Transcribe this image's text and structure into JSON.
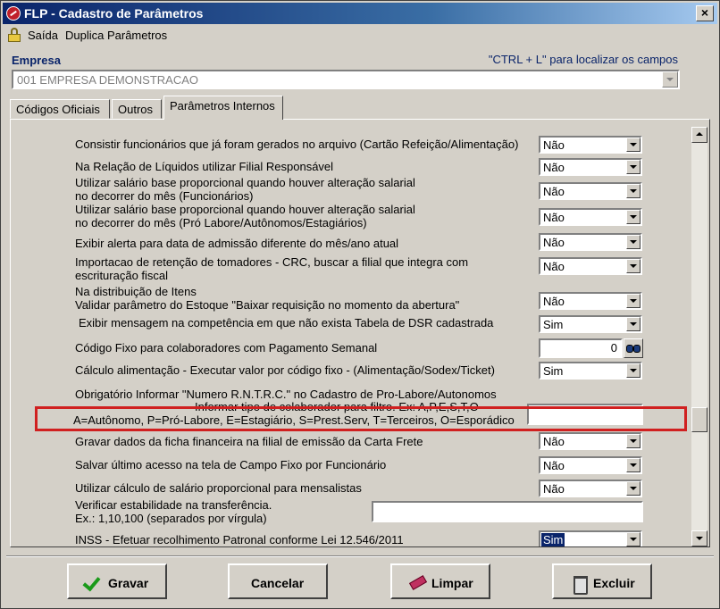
{
  "window": {
    "title": "FLP - Cadastro de Parâmetros",
    "close_glyph": "×"
  },
  "menu": {
    "exit": "Saída",
    "duplicate": "Duplica Parâmetros"
  },
  "empresa": {
    "label": "Empresa",
    "hint": "\"CTRL + L\" para localizar os campos",
    "value": "001 EMPRESA DEMONSTRACAO"
  },
  "tabs": [
    {
      "label": "Códigos Oficiais"
    },
    {
      "label": "Outros"
    },
    {
      "label": "Parâmetros Internos"
    }
  ],
  "rows": [
    {
      "label": "Consistir funcionários que já foram gerados no arquivo (Cartão Refeição/Alimentação)",
      "value": "Não"
    },
    {
      "label": "Na Relação de Líquidos utilizar Filial Responsável",
      "value": "Não"
    },
    {
      "label1": "Utilizar salário base proporcional quando houver alteração salarial",
      "label2": "no decorrer do mês (Funcionários)",
      "value": "Não"
    },
    {
      "label1": "Utilizar salário base proporcional quando houver alteração salarial",
      "label2": "no decorrer do mês (Pró Labore/Autônomos/Estagiários)",
      "value": "Não"
    },
    {
      "label": "Exibir alerta para data de admissão diferente do mês/ano atual",
      "value": "Não"
    },
    {
      "label1": "Importacao de retenção de tomadores - CRC, buscar a filial que integra com",
      "label2": "escrituração fiscal",
      "value": "Não"
    },
    {
      "label1": "Na distribuição de Itens",
      "label2": "Validar parâmetro do Estoque \"Baixar requisição no momento da abertura\"",
      "value": "Não"
    },
    {
      "label": "Exibir mensagem na competência em que não exista Tabela de DSR cadastrada",
      "value": "Sim"
    },
    {
      "label": "Código Fixo para colaboradores com Pagamento Semanal",
      "value": "0"
    },
    {
      "label": "Cálculo alimentação - Executar valor por código fixo - (Alimentação/Sodex/Ticket)",
      "value": "Sim"
    },
    {
      "label": "Obrigatório Informar \"Numero R.N.T.R.C.\" no Cadastro de Pro-Labore/Autonomos"
    },
    {
      "label1": "Informar tipo de colaborador para filtro. Ex: A,P,E,S,T,O",
      "label2": "A=Autônomo, P=Pró-Labore, E=Estagiário, S=Prest.Serv, T=Terceiros, O=Esporádico",
      "value": ""
    },
    {
      "label": "Gravar dados da ficha financeira na filial de emissão da Carta Frete",
      "value": "Não"
    },
    {
      "label": "Salvar último acesso na tela de Campo Fixo por Funcionário",
      "value": "Não"
    },
    {
      "label": "Utilizar cálculo de salário proporcional para mensalistas",
      "value": "Não"
    },
    {
      "label1": "Verificar estabilidade na transferência.",
      "label2": "Ex.: 1,10,100 (separados por vírgula)",
      "value": ""
    },
    {
      "label": "INSS - Efetuar recolhimento Patronal conforme Lei 12.546/2011",
      "value": "Sim"
    }
  ],
  "buttons": {
    "save": "Gravar",
    "cancel": "Cancelar",
    "clear": "Limpar",
    "delete": "Excluir"
  },
  "colors": {
    "highlight": "#d02020",
    "title_bar": "#0a246a",
    "selection": "#0a246a"
  }
}
